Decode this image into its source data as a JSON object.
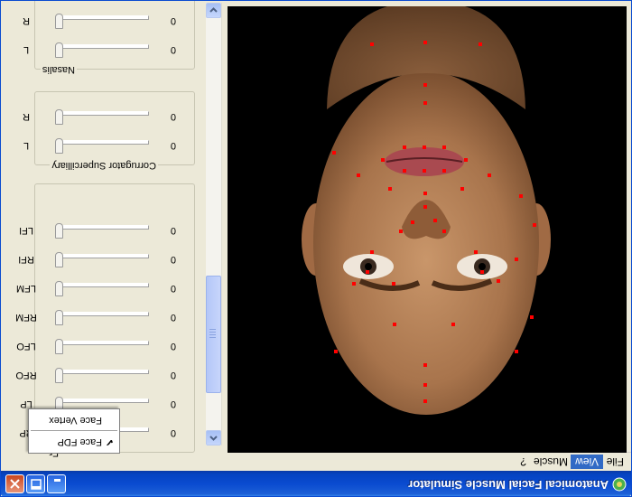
{
  "window": {
    "title": "Anatomical Facial Muscle Simulator",
    "controls": {
      "minimize": "minimize-icon",
      "maximize": "maximize-icon",
      "close": "close-icon"
    }
  },
  "menu": {
    "items": [
      "File",
      "View",
      "Muscle",
      "?"
    ],
    "active": "View",
    "dropdown": {
      "items": [
        {
          "label": "Face FDP",
          "checked": true
        },
        {
          "label": "Face Vertex",
          "checked": false
        }
      ]
    }
  },
  "panel": {
    "groups": [
      {
        "title": "Nasalis",
        "sliders": [
          {
            "label": "R",
            "value": "0"
          },
          {
            "label": "L",
            "value": "0"
          }
        ]
      },
      {
        "title": "Corrugator Supercilliary",
        "sliders": [
          {
            "label": "R",
            "value": "0"
          },
          {
            "label": "L",
            "value": "0"
          }
        ]
      },
      {
        "title": "Fr",
        "sliders": [
          {
            "label": "RP",
            "value": "0"
          },
          {
            "label": "LP",
            "value": "0"
          },
          {
            "label": "RFO",
            "value": "0"
          },
          {
            "label": "LFO",
            "value": "0"
          },
          {
            "label": "RFM",
            "value": "0"
          },
          {
            "label": "LFM",
            "value": "0"
          },
          {
            "label": "RFI",
            "value": "0"
          },
          {
            "label": "LFI",
            "value": "0"
          }
        ]
      }
    ]
  },
  "viewport": {
    "background": "#000000",
    "feature_point_color": "#ff0000",
    "skin_color": "#b5825a"
  }
}
